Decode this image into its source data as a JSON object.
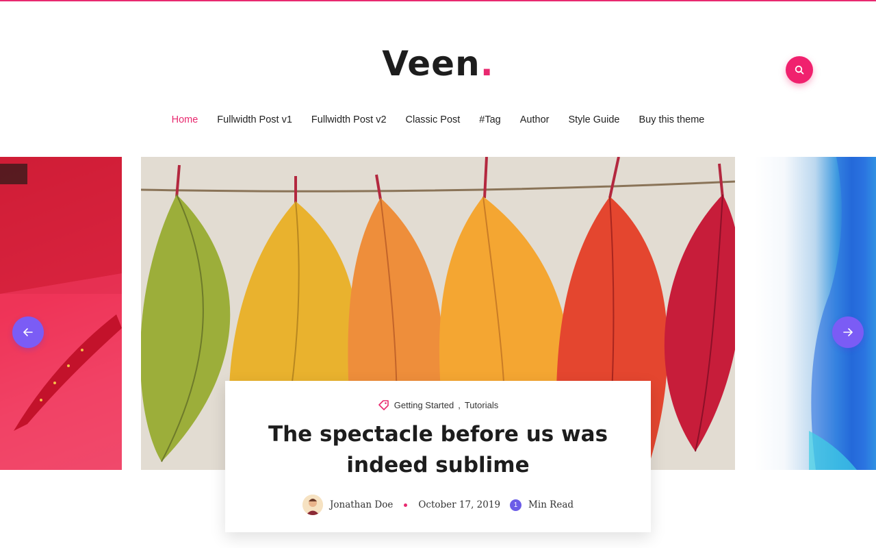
{
  "brand": {
    "name": "Veen",
    "dot": ".",
    "accent": "#e8296f"
  },
  "header": {
    "search_icon": "search-icon"
  },
  "nav": {
    "items": [
      {
        "label": "Home",
        "active": true
      },
      {
        "label": "Fullwidth Post v1"
      },
      {
        "label": "Fullwidth Post v2"
      },
      {
        "label": "Classic Post"
      },
      {
        "label": "#Tag"
      },
      {
        "label": "Author"
      },
      {
        "label": "Style Guide"
      },
      {
        "label": "Buy this theme"
      }
    ]
  },
  "slider": {
    "prev_icon": "arrow-left-icon",
    "next_icon": "arrow-right-icon",
    "arrow_color": "#7b5cf5"
  },
  "post": {
    "tag_icon": "tag-icon",
    "categories": [
      "Getting Started",
      "Tutorials"
    ],
    "category_separator": ",",
    "title": "The spectacle before us was indeed sublime",
    "author": "Jonathan Doe",
    "date": "October 17, 2019",
    "read_time_number": "1",
    "read_time_label": "Min Read"
  }
}
